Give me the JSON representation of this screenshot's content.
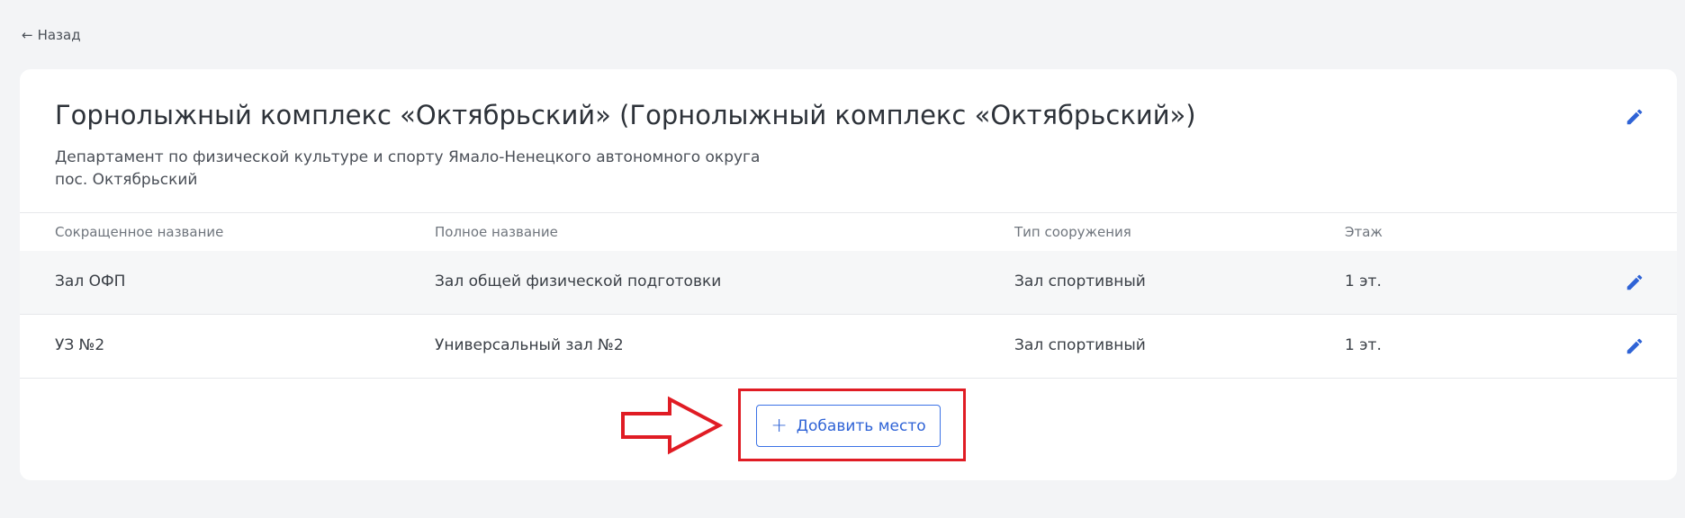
{
  "nav": {
    "back_label": "Назад"
  },
  "facility": {
    "title": "Горнолыжный комплекс «Октябрьский» (Горнолыжный комплекс «Октябрьский»)",
    "department": "Департамент по физической культуре и спорту Ямало-Ненецкого автономного округа",
    "location": "пос. Октябрьский"
  },
  "table": {
    "columns": {
      "short_name": "Сокращенное название",
      "full_name": "Полное название",
      "type": "Тип сооружения",
      "floor": "Этаж"
    },
    "rows": [
      {
        "short_name": "Зал ОФП",
        "full_name": "Зал общей физической подготовки",
        "type": "Зал спортивный",
        "floor": "1 эт."
      },
      {
        "short_name": "УЗ №2",
        "full_name": "Универсальный зал №2",
        "type": "Зал спортивный",
        "floor": "1 эт."
      }
    ]
  },
  "actions": {
    "add_place_label": "Добавить место"
  },
  "icons": {
    "back": "arrow-left-icon",
    "edit": "pencil-icon",
    "add": "plus-icon",
    "annotation": "red-arrow-icon"
  },
  "colors": {
    "accent": "#2f63d6",
    "annotation": "#e01c24",
    "page_background": "#f3f4f6",
    "card_background": "#ffffff"
  }
}
